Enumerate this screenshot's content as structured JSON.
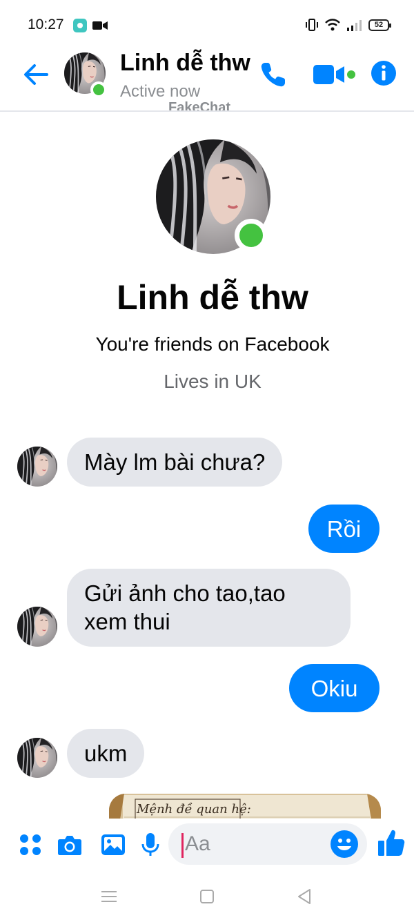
{
  "status_bar": {
    "time": "10:27",
    "battery": "52"
  },
  "header": {
    "name": "Linh dễ thw",
    "status": "Active now",
    "watermark": "FakeChat"
  },
  "profile": {
    "name": "Linh dễ thw",
    "friends_text": "You're friends on Facebook",
    "lives_text": "Lives in UK"
  },
  "messages": [
    {
      "direction": "in",
      "text": "Mày lm bài chưa?"
    },
    {
      "direction": "out",
      "text": "Rồi"
    },
    {
      "direction": "in",
      "text": "Gửi ảnh cho tao,tao xem thui"
    },
    {
      "direction": "out",
      "text": "Okiu"
    },
    {
      "direction": "in",
      "text": "ukm"
    },
    {
      "direction": "in",
      "type": "photo",
      "text": "Mệnh đề quan hệ:"
    }
  ],
  "composer": {
    "placeholder": "Aa"
  },
  "colors": {
    "accent": "#0084ff",
    "online": "#44c240",
    "bubble_in": "#e4e6eb",
    "secondary_text": "#65676b"
  },
  "icons": {
    "header": [
      "back-arrow-icon",
      "phone-icon",
      "video-camera-icon",
      "info-icon"
    ],
    "composer": [
      "apps-grid-icon",
      "camera-icon",
      "image-icon",
      "microphone-icon",
      "emoji-icon",
      "thumbs-up-icon"
    ],
    "nav": [
      "menu-icon",
      "home-square-icon",
      "back-triangle-icon"
    ]
  }
}
